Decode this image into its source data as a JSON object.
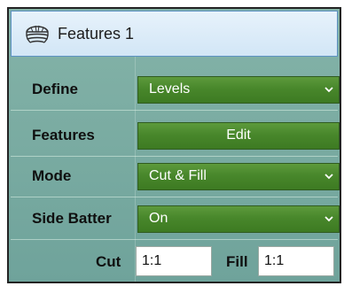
{
  "panel": {
    "title": "Features 1",
    "icon": "strata-layers-icon"
  },
  "rows": {
    "define": {
      "label": "Define",
      "value": "Levels"
    },
    "features": {
      "label": "Features",
      "button_label": "Edit"
    },
    "mode": {
      "label": "Mode",
      "value": "Cut & Fill"
    },
    "side_batter": {
      "label": "Side Batter",
      "value": "On"
    }
  },
  "ratios": {
    "cut_label": "Cut",
    "cut_value": "1:1",
    "fill_label": "Fill",
    "fill_value": "1:1"
  },
  "colors": {
    "panel_bg": "#7aab9f",
    "control_green": "#48872b",
    "header_border": "#5e93c4"
  }
}
